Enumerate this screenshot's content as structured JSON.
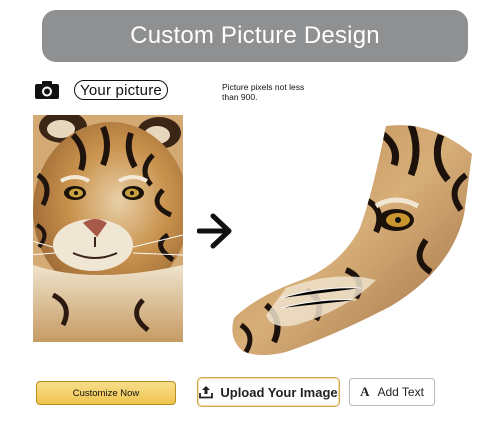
{
  "header": {
    "title": "Custom Picture Design"
  },
  "your_picture": {
    "icon": "camera-icon",
    "label": "Your picture"
  },
  "note": {
    "text": "Picture pixels not less than 900."
  },
  "arrow": {
    "icon": "right-arrow-icon"
  },
  "buttons": {
    "customize_label": "Customize Now",
    "upload_label": "Upload Your Image",
    "upload_icon": "upload-icon",
    "add_text_label": "Add Text",
    "add_text_icon": "text-A-icon"
  },
  "colors": {
    "banner": "#8f9091",
    "customize_bg": "#f0c44f",
    "upload_border": "#d3a34a"
  }
}
